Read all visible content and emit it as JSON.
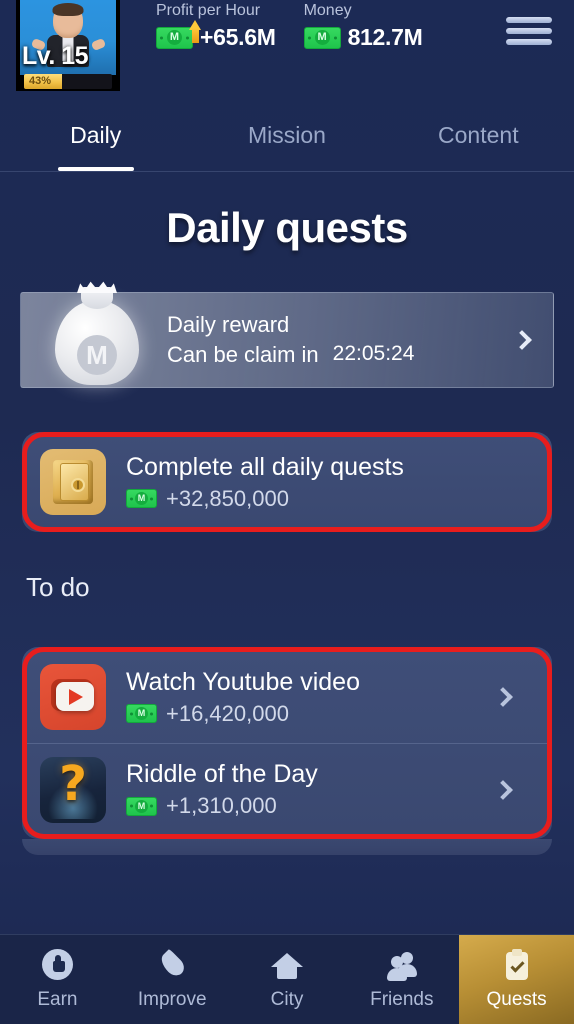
{
  "header": {
    "avatar": {
      "level_label": "Lv. 15",
      "progress_pct_label": "43%",
      "progress_value": 43,
      "icon": "player-avatar"
    },
    "stats": [
      {
        "label": "Profit per Hour",
        "value": "+65.6M",
        "icon": "money-note-up-arrow-icon"
      },
      {
        "label": "Money",
        "value": "812.7M",
        "icon": "money-note-icon"
      }
    ],
    "menu_icon": "hamburger-menu-icon"
  },
  "tabs": [
    {
      "label": "Daily",
      "active": true
    },
    {
      "label": "Mission",
      "active": false
    },
    {
      "label": "Content",
      "active": false
    }
  ],
  "page_title": "Daily quests",
  "daily_reward": {
    "title": "Daily reward",
    "subtitle": "Can be claim in",
    "timer": "22:05:24",
    "icon": "money-bag-icon",
    "chevron": "chevron-right-icon"
  },
  "complete_all": {
    "title": "Complete all daily quests",
    "reward": "+32,850,000",
    "icon": "gold-safe-icon",
    "highlighted": true
  },
  "todo": {
    "section_label": "To do",
    "items": [
      {
        "title": "Watch Youtube video",
        "reward": "+16,420,000",
        "icon": "youtube-play-icon",
        "chevron": "chevron-right-icon"
      },
      {
        "title": "Riddle of the Day",
        "reward": "+1,310,000",
        "icon": "question-mark-icon",
        "chevron": "chevron-right-icon"
      }
    ],
    "highlighted": true
  },
  "bottom_nav": [
    {
      "label": "Earn",
      "icon": "thumbs-up-icon",
      "active": false
    },
    {
      "label": "Improve",
      "icon": "flame-icon",
      "active": false
    },
    {
      "label": "City",
      "icon": "house-icon",
      "active": false
    },
    {
      "label": "Friends",
      "icon": "people-icon",
      "active": false
    },
    {
      "label": "Quests",
      "icon": "clipboard-check-icon",
      "active": true
    }
  ],
  "colors": {
    "background": "#1e2a52",
    "card": "#3f4e78",
    "accent_gold": "#d5ab4c",
    "money_green": "#26c94e",
    "highlight_red": "#e81d1d",
    "text_primary": "#ffffff",
    "text_muted": "#aebad6"
  }
}
